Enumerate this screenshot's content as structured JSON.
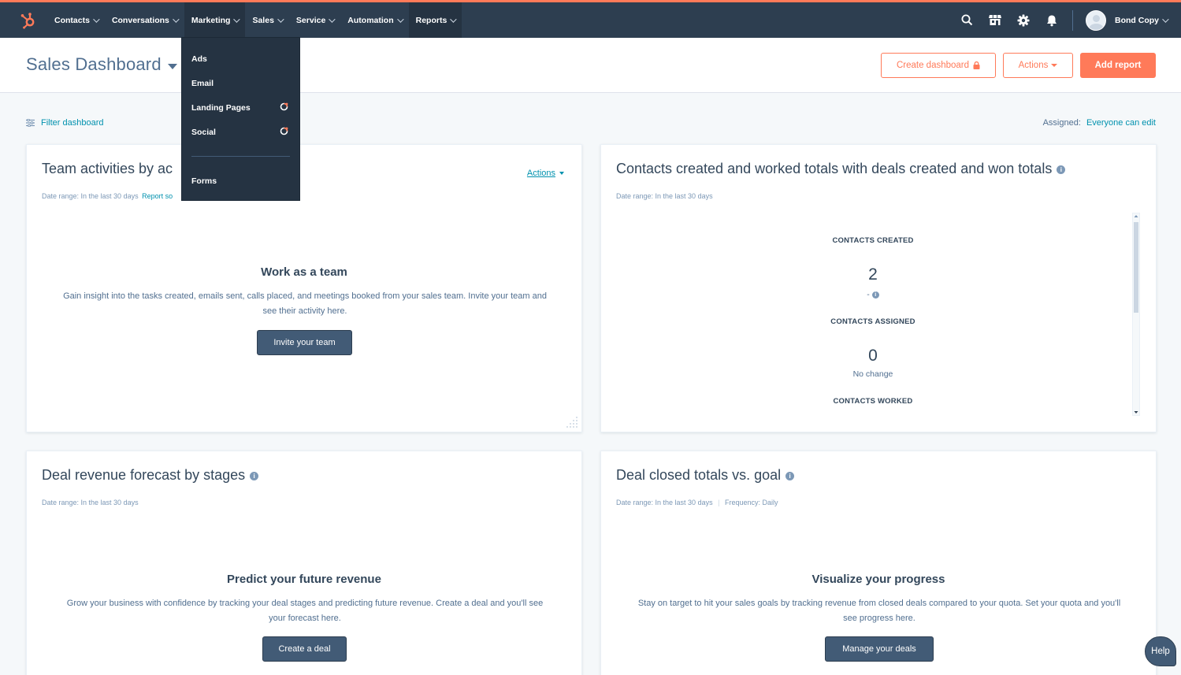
{
  "nav": {
    "items": [
      {
        "label": "Contacts"
      },
      {
        "label": "Conversations"
      },
      {
        "label": "Marketing"
      },
      {
        "label": "Sales"
      },
      {
        "label": "Service"
      },
      {
        "label": "Automation"
      },
      {
        "label": "Reports"
      }
    ],
    "account_name": "Bond Copy"
  },
  "marketing_menu": {
    "items": [
      {
        "label": "Ads"
      },
      {
        "label": "Email"
      },
      {
        "label": "Landing Pages"
      },
      {
        "label": "Social"
      },
      {
        "label": "Forms"
      }
    ]
  },
  "header": {
    "title": "Sales Dashboard",
    "create_dashboard": "Create dashboard",
    "actions": "Actions",
    "add_report": "Add report"
  },
  "filter": {
    "label": "Filter dashboard",
    "assigned_label": "Assigned:",
    "assigned_value": "Everyone can edit"
  },
  "cards": {
    "team": {
      "title": "Team activities by ac",
      "date_range": "Date range: In the last 30 days",
      "report_link": "Report so",
      "actions": "Actions",
      "empty_title": "Work as a team",
      "empty_desc": "Gain insight into the tasks created, emails sent, calls placed, and meetings booked from your sales team. Invite your team and see their activity here.",
      "button": "Invite your team"
    },
    "contacts": {
      "title": "Contacts created and worked totals with deals created and won totals",
      "date_range": "Date range: In the last 30 days",
      "stats": [
        {
          "label": "CONTACTS CREATED",
          "value": "2",
          "note": "-"
        },
        {
          "label": "CONTACTS ASSIGNED",
          "value": "0",
          "note": "No change"
        },
        {
          "label": "CONTACTS WORKED"
        }
      ]
    },
    "forecast": {
      "title": "Deal revenue forecast by stages",
      "date_range": "Date range: In the last 30 days",
      "empty_title": "Predict your future revenue",
      "empty_desc": "Grow your business with confidence by tracking your deal stages and predicting future revenue. Create a deal and you'll see your forecast here.",
      "button": "Create a deal"
    },
    "closed": {
      "title": "Deal closed totals vs. goal",
      "date_range": "Date range: In the last 30 days",
      "frequency": "Frequency: Daily",
      "empty_title": "Visualize your progress",
      "empty_desc": "Stay on target to hit your sales goals by tracking revenue from closed deals compared to your quota. Set your quota and you'll see progress here.",
      "button": "Manage your deals"
    }
  },
  "help": "Help",
  "colors": {
    "nav_bg": "#2d3e50",
    "accent": "#ff7a59",
    "link": "#0091ae",
    "button_dark": "#425b76"
  }
}
